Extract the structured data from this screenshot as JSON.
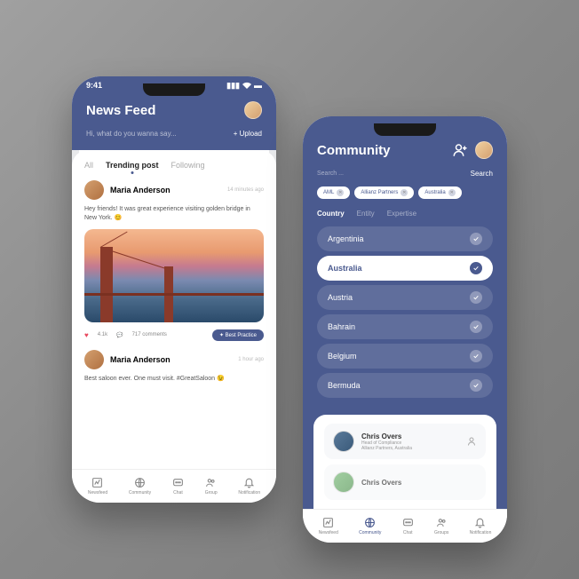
{
  "phone1": {
    "statusTime": "9:41",
    "title": "News Feed",
    "composePlaceholder": "Hi, what do you wanna say...",
    "uploadLabel": "+ Upload",
    "tabs": {
      "all": "All",
      "trending": "Trending post",
      "following": "Following"
    },
    "post1": {
      "author": "Maria Anderson",
      "time": "14 minutes ago",
      "text": "Hey friends! It was great experience visiting golden bridge in New York. 😊",
      "likes": "4.1k",
      "comments": "717 comments",
      "badge": "Best Practice"
    },
    "post2": {
      "author": "Maria Anderson",
      "time": "1 hour ago",
      "text": "Best saloon ever. One must visit. #GreatSaloon 😉"
    },
    "nav": {
      "newsfeed": "Newsfeed",
      "community": "Community",
      "chat": "Chat",
      "group": "Group",
      "notification": "Notification"
    }
  },
  "phone2": {
    "title": "Community",
    "searchPlaceholder": "Search ...",
    "searchBtn": "Search",
    "chips": {
      "c1": "AML",
      "c2": "Allianz Partners",
      "c3": "Australia"
    },
    "filterTabs": {
      "country": "Country",
      "entity": "Entity",
      "expertise": "Expertise"
    },
    "countries": {
      "argentinia": "Argentinia",
      "australia": "Australia",
      "austria": "Austria",
      "bahrain": "Bahrain",
      "belgium": "Belgium",
      "bermuda": "Bermuda"
    },
    "person1": {
      "name": "Chris Overs",
      "role": "Head of Compliance",
      "org": "Allianz Partners, Australia"
    },
    "person2": {
      "name": "Chris Overs"
    },
    "nav": {
      "newsfeed": "Newsfeed",
      "community": "Community",
      "chat": "Chat",
      "groups": "Groups",
      "notification": "Notification"
    }
  }
}
